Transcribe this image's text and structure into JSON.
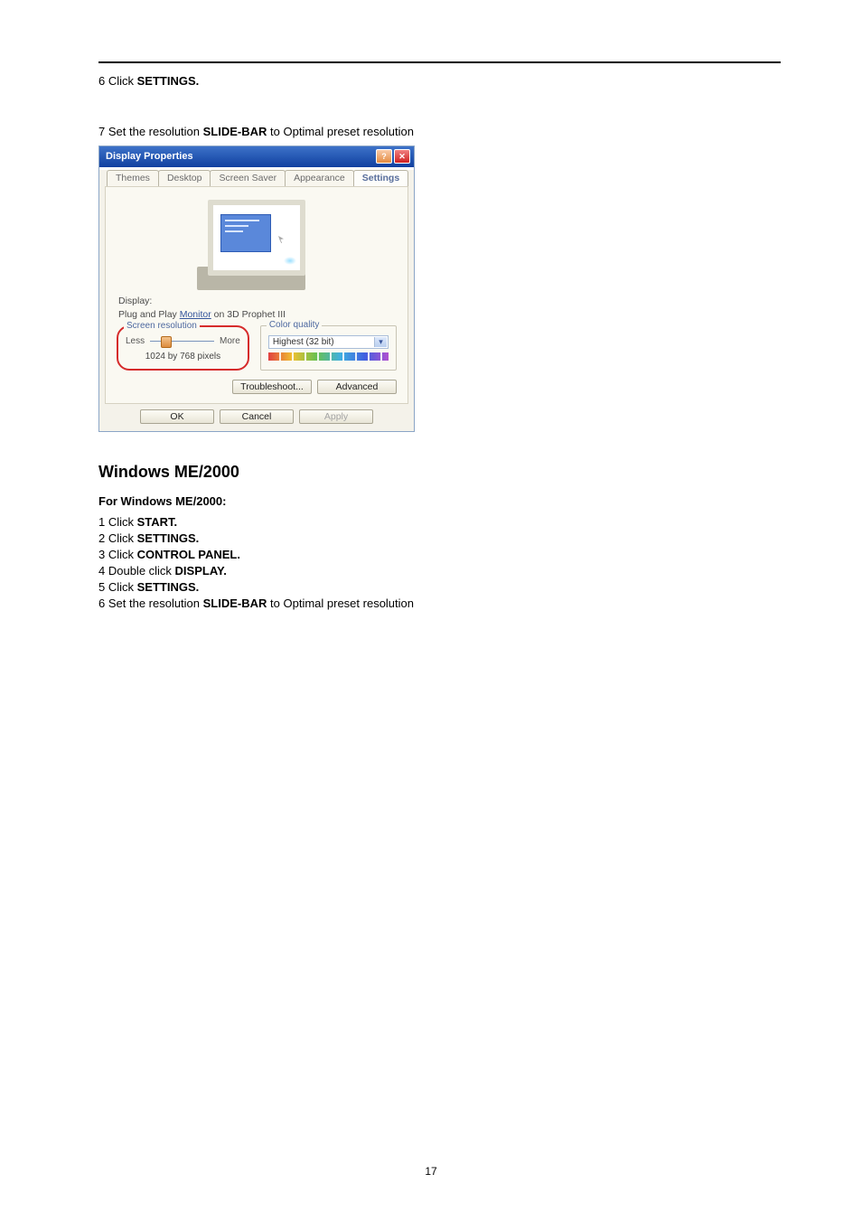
{
  "page_number": "17",
  "top_steps": {
    "line6": {
      "num": "6",
      "pre": " Click ",
      "b": "SETTINGS."
    },
    "line7": {
      "num": "7",
      "pre": " Set the resolution ",
      "b": "SLIDE-BAR",
      "post": " to Optimal preset resolution"
    }
  },
  "dialog": {
    "title": "Display Properties",
    "tabs": [
      "Themes",
      "Desktop",
      "Screen Saver",
      "Appearance",
      "Settings"
    ],
    "display_label": "Display:",
    "display_value_pre": "Plug and Play ",
    "display_value_link": "Monitor",
    "display_value_post": " on 3D Prophet III",
    "screen_res": {
      "legend": "Screen resolution",
      "less": "Less",
      "more": "More",
      "value": "1024 by 768 pixels"
    },
    "color_quality": {
      "legend": "Color quality",
      "value": "Highest (32 bit)"
    },
    "buttons": {
      "troubleshoot": "Troubleshoot...",
      "advanced": "Advanced",
      "ok": "OK",
      "cancel": "Cancel",
      "apply": "Apply"
    }
  },
  "section": {
    "heading": "Windows ME/2000",
    "subheading": "For Windows ME/2000:",
    "steps": [
      {
        "num": "1",
        "pre": " Click ",
        "b": "START."
      },
      {
        "num": "2",
        "pre": " Click ",
        "b": "SETTINGS."
      },
      {
        "num": "3",
        "pre": " Click ",
        "b": "CONTROL PANEL."
      },
      {
        "num": "4",
        "pre": " Double click ",
        "b": "DISPLAY."
      },
      {
        "num": "5",
        "pre": " Click ",
        "b": "SETTINGS."
      },
      {
        "num": "6",
        "pre": " Set the resolution ",
        "b": "SLIDE-BAR",
        "post": " to Optimal preset resolution"
      }
    ]
  }
}
